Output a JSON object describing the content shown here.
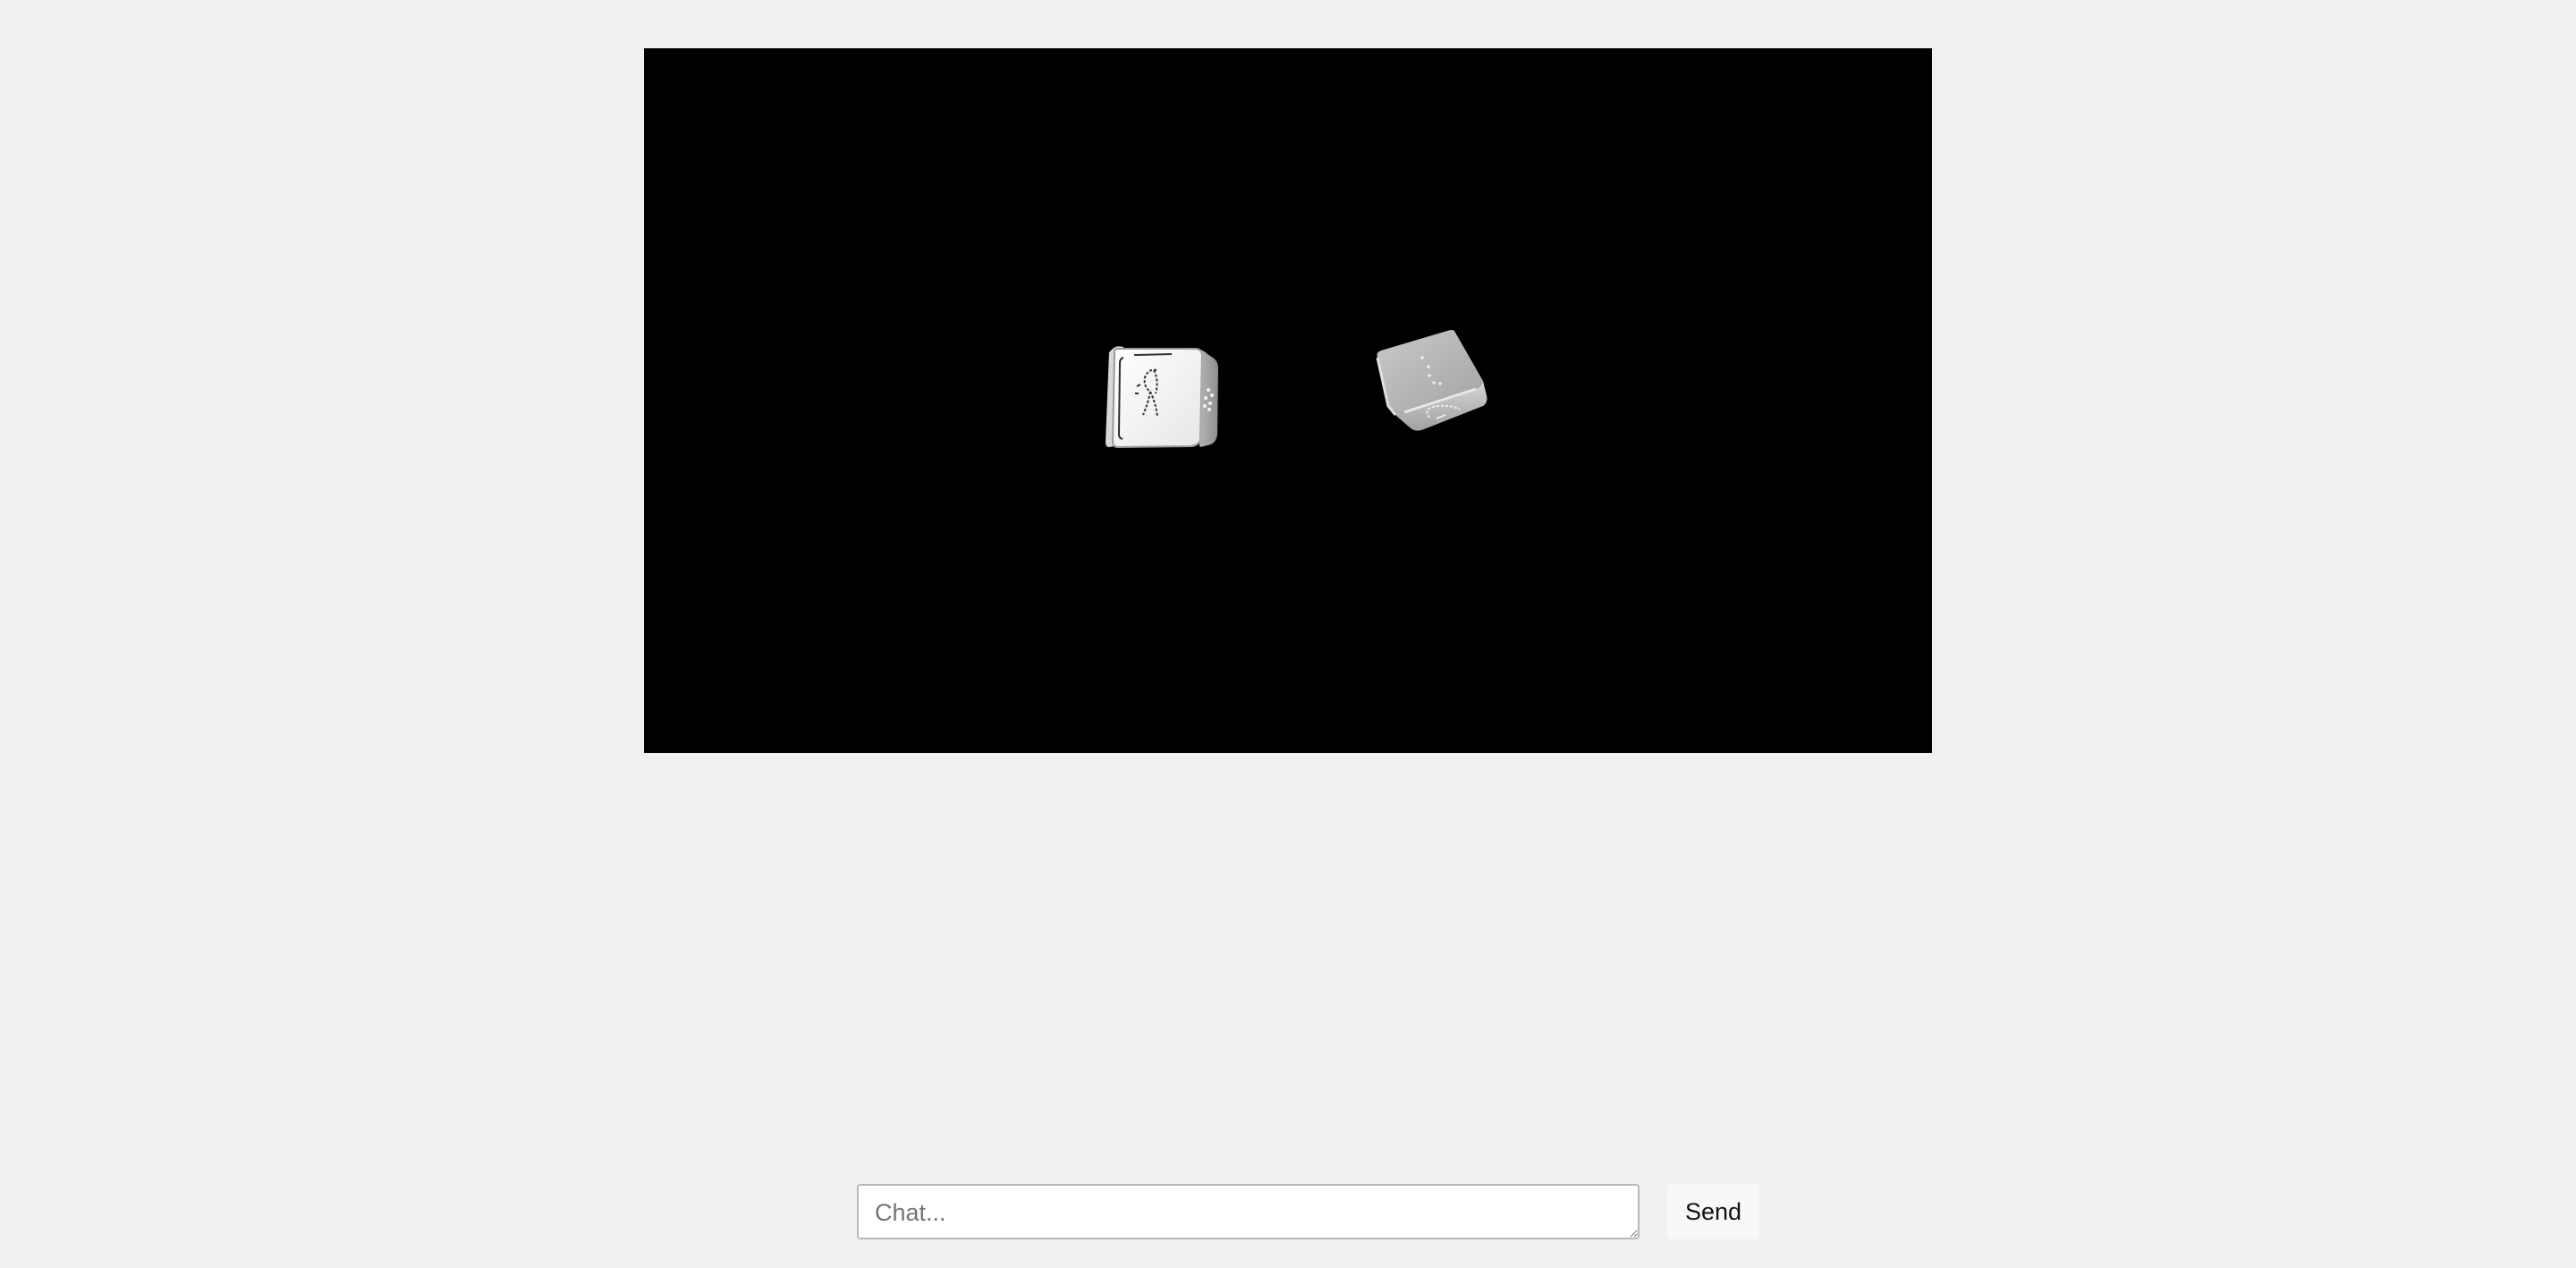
{
  "scene": {
    "background_color": "#000000",
    "dice": [
      {
        "description": "die-left",
        "face_color": "#f4f4f4"
      },
      {
        "description": "die-right",
        "face_color": "#b4b4b4"
      }
    ]
  },
  "chat": {
    "placeholder": "Chat...",
    "value": "",
    "send_label": "Send"
  },
  "colors": {
    "page_background": "#f0f0f0",
    "viewport_background": "#000000",
    "button_background": "#f8f8f8"
  }
}
